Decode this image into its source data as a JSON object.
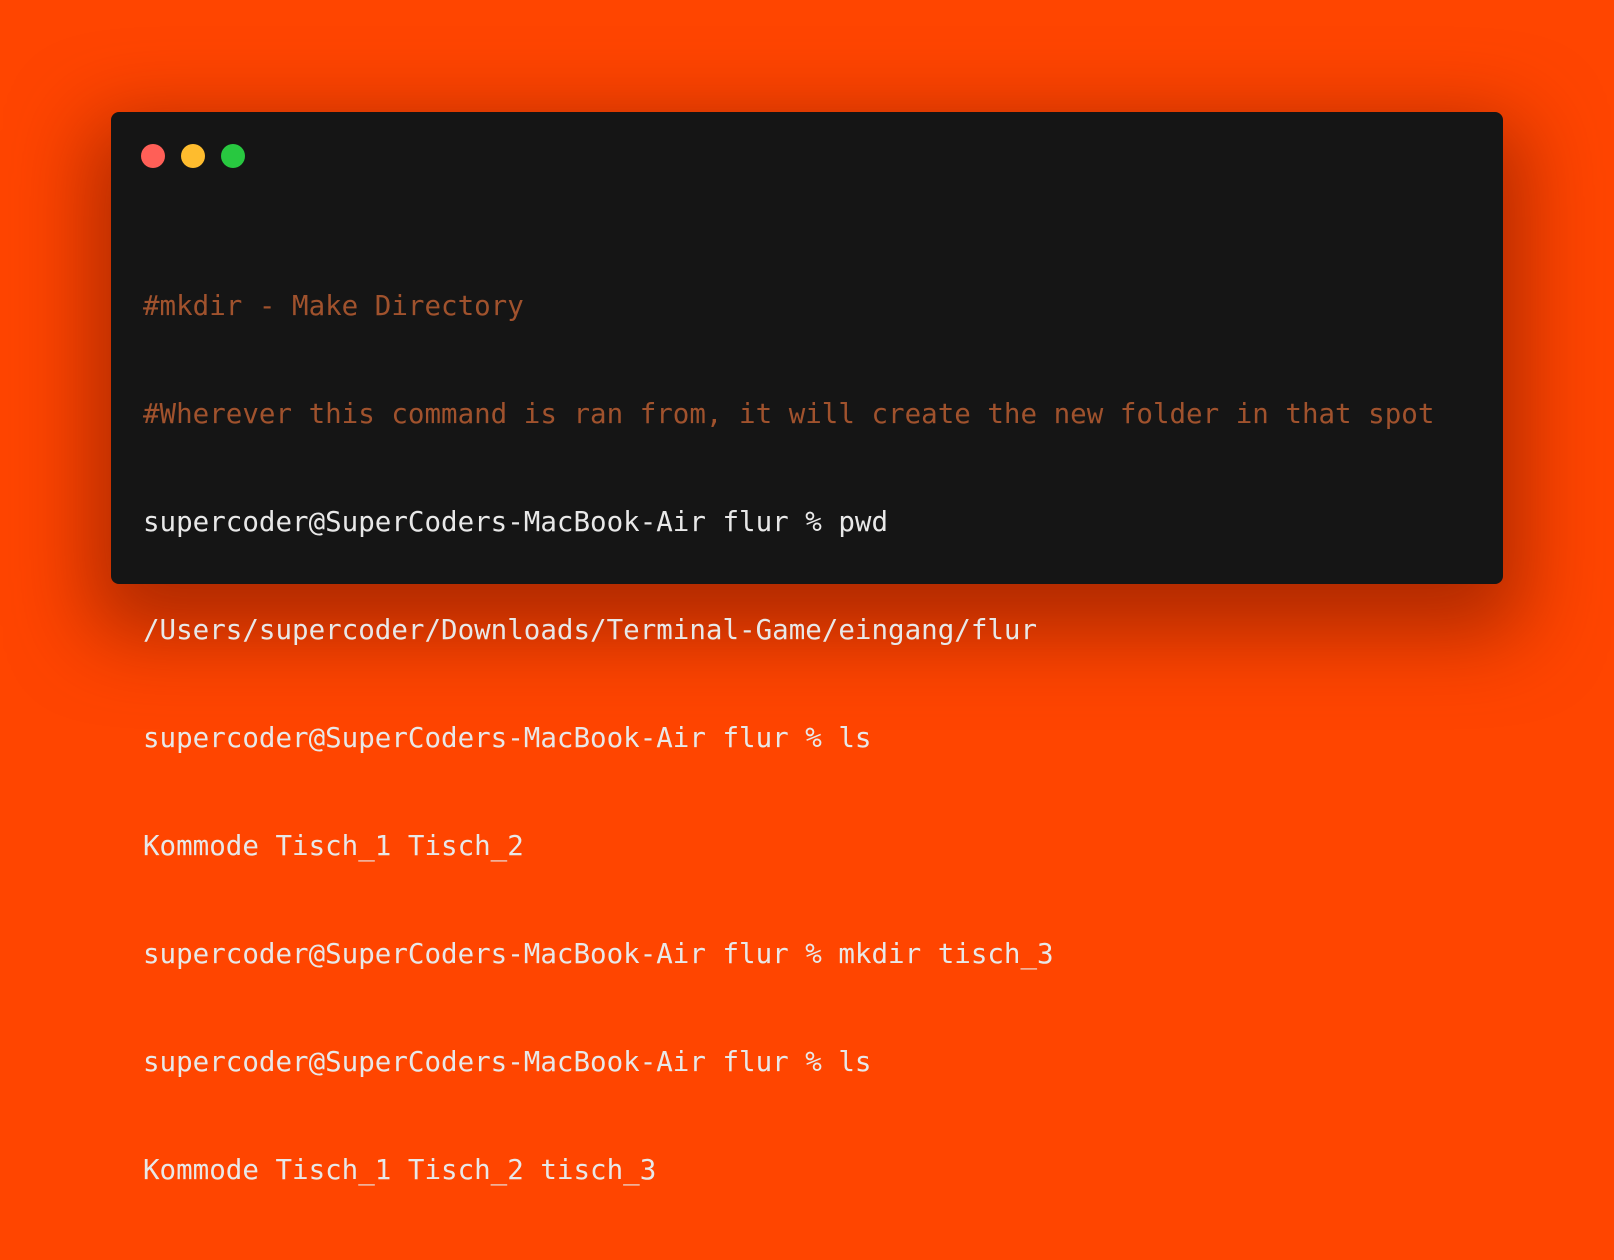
{
  "colors": {
    "background": "#ff4500",
    "window": "#151515",
    "close": "#ff5f57",
    "minimize": "#febc2e",
    "zoom": "#28c840",
    "comment": "#a0522d",
    "text": "#e8e8e8"
  },
  "window_controls": {
    "close": "close-button",
    "minimize": "minimize-button",
    "zoom": "zoom-button"
  },
  "terminal": {
    "lines": [
      {
        "kind": "comment",
        "text": "#mkdir - Make Directory"
      },
      {
        "kind": "comment",
        "text": "#Wherever this command is ran from, it will create the new folder in that spot"
      },
      {
        "kind": "command",
        "text": "supercoder@SuperCoders-MacBook-Air flur % pwd"
      },
      {
        "kind": "output",
        "text": "/Users/supercoder/Downloads/Terminal-Game/eingang/flur"
      },
      {
        "kind": "command",
        "text": "supercoder@SuperCoders-MacBook-Air flur % ls"
      },
      {
        "kind": "output",
        "text": "Kommode Tisch_1 Tisch_2"
      },
      {
        "kind": "command",
        "text": "supercoder@SuperCoders-MacBook-Air flur % mkdir tisch_3"
      },
      {
        "kind": "command",
        "text": "supercoder@SuperCoders-MacBook-Air flur % ls"
      },
      {
        "kind": "output",
        "text": "Kommode Tisch_1 Tisch_2 tisch_3"
      }
    ]
  }
}
